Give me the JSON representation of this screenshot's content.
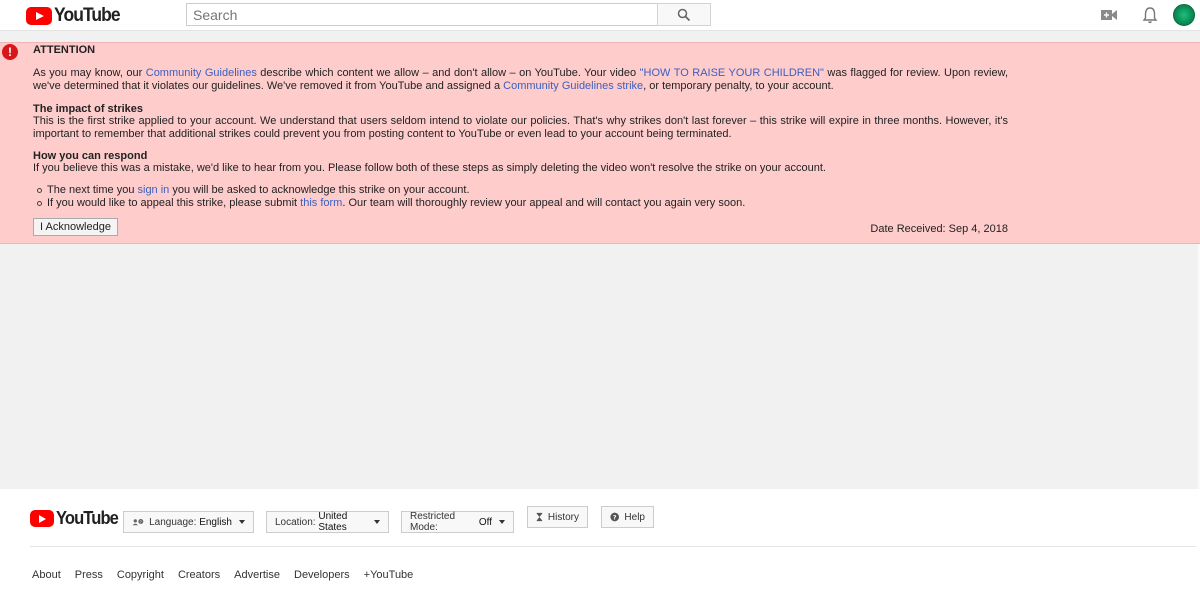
{
  "header": {
    "logo_text": "YouTube",
    "search_placeholder": "Search",
    "icons": [
      "search-icon",
      "video-camera-icon",
      "bell-icon",
      "avatar"
    ]
  },
  "banner": {
    "title": "ATTENTION",
    "p1_a": "As you may know, our ",
    "p1_link1": "Community Guidelines",
    "p1_b": " describe which content we allow – and don't allow – on YouTube. Your video ",
    "p1_link2": "\"HOW TO RAISE YOUR CHILDREN\"",
    "p1_c": " was flagged for review. Upon review, we've determined that it violates our guidelines. We've removed it from YouTube and assigned a ",
    "p1_link3": "Community Guidelines strike",
    "p1_d": ", or temporary penalty, to your account.",
    "impact_heading": "The impact of strikes",
    "impact_text": "This is the first strike applied to your account. We understand that users seldom intend to violate our policies. That's why strikes don't last forever – this strike will expire in three months. However, it's important to remember that additional strikes could prevent you from posting content to YouTube or even lead to your account being terminated.",
    "respond_heading": "How you can respond",
    "respond_text": "If you believe this was a mistake, we'd like to hear from you. Please follow both of these steps as simply deleting the video won't resolve the strike on your account.",
    "bullet1_a": "The next time you ",
    "bullet1_link": "sign in",
    "bullet1_b": " you will be asked to acknowledge this strike on your account.",
    "bullet2_a": "If you would like to appeal this strike, please submit ",
    "bullet2_link": "this form",
    "bullet2_b": ". Our team will thoroughly review your appeal and will contact you again very soon.",
    "ack_button": "I Acknowledge",
    "date_received": "Date Received: Sep 4, 2018",
    "colors": {
      "background": "#ffcccc",
      "link": "#3b5fc0",
      "alert": "#d9161c"
    }
  },
  "footer": {
    "logo_text": "YouTube",
    "language_label": "Language:",
    "language_value": "English",
    "location_label": "Location:",
    "location_value": "United States",
    "restricted_label": "Restricted Mode:",
    "restricted_value": "Off",
    "history_label": "History",
    "help_label": "Help",
    "links": [
      "About",
      "Press",
      "Copyright",
      "Creators",
      "Advertise",
      "Developers",
      "+YouTube"
    ]
  }
}
